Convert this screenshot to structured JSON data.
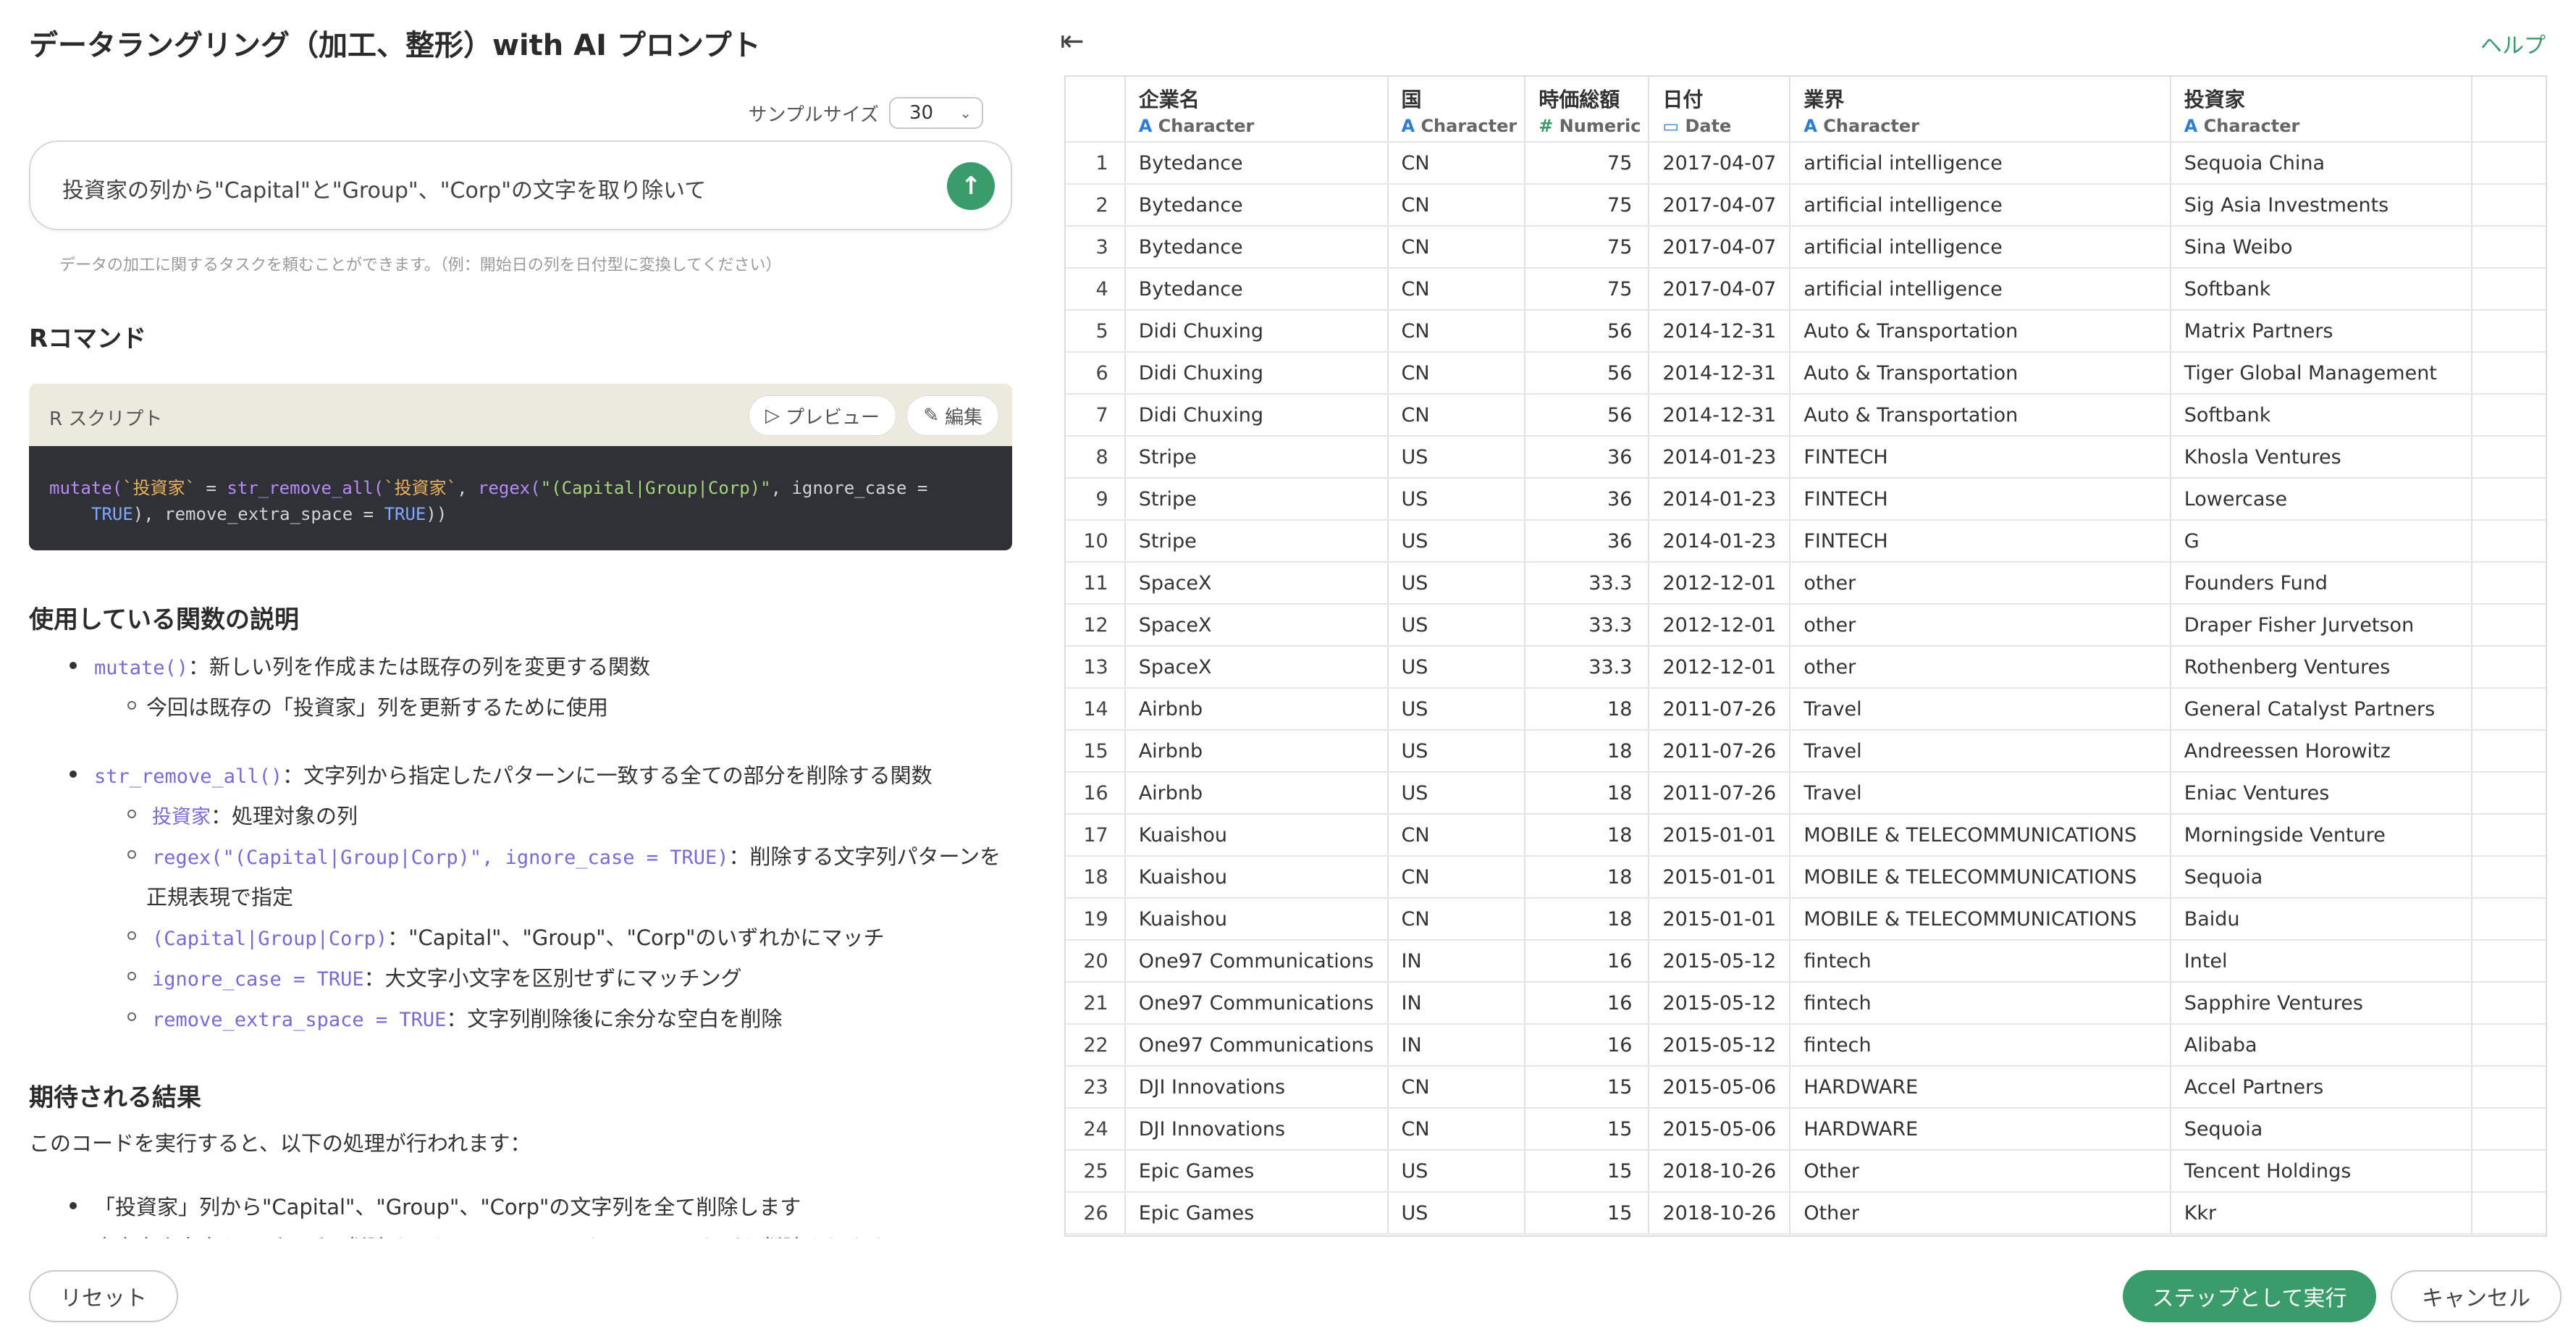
{
  "dialog": {
    "title": "データラングリング（加工、整形）with AI プロンプト",
    "help": "ヘルプ"
  },
  "sample": {
    "label": "サンプルサイズ",
    "value": "30"
  },
  "prompt": {
    "text": "投資家の列から\"Capital\"と\"Group\"、\"Corp\"の文字を取り除いて",
    "hint": "データの加工に関するタスクを頼むことができます。（例：開始日の列を日付型に変換してください）"
  },
  "r_section": {
    "heading": "Rコマンド",
    "card_label": "R スクリプト",
    "preview": "プレビュー",
    "edit": "編集"
  },
  "code": {
    "line1_a": "mutate(",
    "line1_b": "`投資家`",
    "line1_c": " = ",
    "line1_d": "str_remove_all(",
    "line1_e": "`投資家`",
    "line1_f": ", ",
    "line1_g": "regex(",
    "line1_h": "\"(Capital|Group|Corp)\"",
    "line1_i": ", ignore_case =",
    "line2_a": "TRUE",
    "line2_b": "), remove_extra_space = ",
    "line2_c": "TRUE",
    "line2_d": "))"
  },
  "explain": {
    "heading": "使用している関数の説明",
    "b1_code": "mutate()",
    "b1_text": "：新しい列を作成または既存の列を変更する関数",
    "b1_sub": "今回は既存の「投資家」列を更新するために使用",
    "b2_code": "str_remove_all()",
    "b2_text": "：文字列から指定したパターンに一致する全ての部分を削除する関数",
    "b2_s1_code": "投資家",
    "b2_s1_text": "：処理対象の列",
    "b2_s2_code": "regex(\"(Capital|Group|Corp)\", ignore_case = TRUE)",
    "b2_s2_text": "：削除する文字列パターンを",
    "b2_s2_cont": "正規表現で指定",
    "b2_s3_code": "(Capital|Group|Corp)",
    "b2_s3_text": "：\"Capital\"、\"Group\"、\"Corp\"のいずれかにマッチ",
    "b2_s4_code": "ignore_case = TRUE",
    "b2_s4_text": "：大文字小文字を区別せずにマッチング",
    "b2_s5_code": "remove_extra_space = TRUE",
    "b2_s5_text": "：文字列削除後に余分な空白を削除"
  },
  "result": {
    "heading": "期待される結果",
    "intro": "このコードを実行すると、以下の処理が行われます：",
    "b1": "「投資家」列から\"Capital\"、\"Group\"、\"Corp\"の文字列を全て削除します",
    "b2": "大文字小文字を区別せずに削除するため、\"capital\"や\"GROUP\"なども削除されます"
  },
  "table": {
    "columns": [
      {
        "name": "企業名",
        "type": "Character",
        "type_icon": "A"
      },
      {
        "name": "国",
        "type": "Character",
        "type_icon": "A"
      },
      {
        "name": "時価総額",
        "type": "Numeric",
        "type_icon": "#"
      },
      {
        "name": "日付",
        "type": "Date",
        "type_icon": "calendar-icon"
      },
      {
        "name": "業界",
        "type": "Character",
        "type_icon": "A"
      },
      {
        "name": "投資家",
        "type": "Character",
        "type_icon": "A"
      }
    ],
    "rows": [
      [
        "1",
        "Bytedance",
        "CN",
        "75",
        "2017-04-07",
        "artificial intelligence",
        "Sequoia China"
      ],
      [
        "2",
        "Bytedance",
        "CN",
        "75",
        "2017-04-07",
        "artificial intelligence",
        "Sig Asia Investments"
      ],
      [
        "3",
        "Bytedance",
        "CN",
        "75",
        "2017-04-07",
        "artificial intelligence",
        "Sina Weibo"
      ],
      [
        "4",
        "Bytedance",
        "CN",
        "75",
        "2017-04-07",
        "artificial intelligence",
        "Softbank"
      ],
      [
        "5",
        "Didi Chuxing",
        "CN",
        "56",
        "2014-12-31",
        "Auto & Transportation",
        "Matrix Partners"
      ],
      [
        "6",
        "Didi Chuxing",
        "CN",
        "56",
        "2014-12-31",
        "Auto & Transportation",
        "Tiger Global Management"
      ],
      [
        "7",
        "Didi Chuxing",
        "CN",
        "56",
        "2014-12-31",
        "Auto & Transportation",
        "Softbank"
      ],
      [
        "8",
        "Stripe",
        "US",
        "36",
        "2014-01-23",
        "FINTECH",
        "Khosla Ventures"
      ],
      [
        "9",
        "Stripe",
        "US",
        "36",
        "2014-01-23",
        "FINTECH",
        "Lowercase"
      ],
      [
        "10",
        "Stripe",
        "US",
        "36",
        "2014-01-23",
        "FINTECH",
        "G"
      ],
      [
        "11",
        "SpaceX",
        "US",
        "33.3",
        "2012-12-01",
        "other",
        "Founders Fund"
      ],
      [
        "12",
        "SpaceX",
        "US",
        "33.3",
        "2012-12-01",
        "other",
        "Draper Fisher Jurvetson"
      ],
      [
        "13",
        "SpaceX",
        "US",
        "33.3",
        "2012-12-01",
        "other",
        "Rothenberg Ventures"
      ],
      [
        "14",
        "Airbnb",
        "US",
        "18",
        "2011-07-26",
        "Travel",
        "General Catalyst Partners"
      ],
      [
        "15",
        "Airbnb",
        "US",
        "18",
        "2011-07-26",
        "Travel",
        "Andreessen Horowitz"
      ],
      [
        "16",
        "Airbnb",
        "US",
        "18",
        "2011-07-26",
        "Travel",
        "Eniac Ventures"
      ],
      [
        "17",
        "Kuaishou",
        "CN",
        "18",
        "2015-01-01",
        "MOBILE & TELECOMMUNICATIONS",
        "Morningside Venture"
      ],
      [
        "18",
        "Kuaishou",
        "CN",
        "18",
        "2015-01-01",
        "MOBILE & TELECOMMUNICATIONS",
        "Sequoia"
      ],
      [
        "19",
        "Kuaishou",
        "CN",
        "18",
        "2015-01-01",
        "MOBILE & TELECOMMUNICATIONS",
        "Baidu"
      ],
      [
        "20",
        "One97 Communications",
        "IN",
        "16",
        "2015-05-12",
        "fintech",
        "Intel"
      ],
      [
        "21",
        "One97 Communications",
        "IN",
        "16",
        "2015-05-12",
        "fintech",
        "Sapphire Ventures"
      ],
      [
        "22",
        "One97 Communications",
        "IN",
        "16",
        "2015-05-12",
        "fintech",
        "Alibaba"
      ],
      [
        "23",
        "DJI Innovations",
        "CN",
        "15",
        "2015-05-06",
        "HARDWARE",
        "Accel Partners"
      ],
      [
        "24",
        "DJI Innovations",
        "CN",
        "15",
        "2015-05-06",
        "HARDWARE",
        "Sequoia"
      ],
      [
        "25",
        "Epic Games",
        "US",
        "15",
        "2018-10-26",
        "Other",
        "Tencent Holdings"
      ],
      [
        "26",
        "Epic Games",
        "US",
        "15",
        "2018-10-26",
        "Other",
        "Kkr"
      ]
    ]
  },
  "footer": {
    "reset": "リセット",
    "run": "ステップとして実行",
    "cancel": "キャンセル"
  },
  "colors": {
    "accent": "#3a9c6a",
    "code_bg": "#2f3136",
    "type_blue": "#2d7dd2"
  }
}
